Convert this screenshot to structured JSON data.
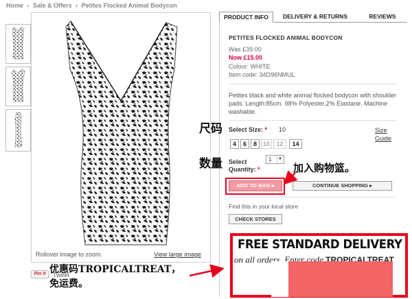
{
  "breadcrumb": {
    "home": "Home",
    "sale": "Sale & Offers",
    "product": "Petites Flocked Animal Bodycon",
    "separator": "›"
  },
  "gallery": {
    "rollover_text": "Rollover image to zoom.",
    "view_large": "View large image"
  },
  "social": {
    "pinit": "Pin it",
    "tweet": "Tweet"
  },
  "tabs": {
    "product_info": "PRODUCT INFO",
    "delivery": "DELIVERY & RETURNS",
    "reviews": "REVIEWS"
  },
  "product": {
    "title": "PETITES FLOCKED ANIMAL BODYCON",
    "was": "Was £39.00",
    "now": "Now £15.00",
    "colour": "Colour: WHITE",
    "item_code": "Item code: 34D96NMUL",
    "description": "Petites black and white animal flocked bodycon with shoulder pads. Length:85cm. 98% Polyester,2% Elastane. Machine washable."
  },
  "size": {
    "label": "Select Size:",
    "required_mark": "*",
    "selected": "10",
    "guide": "Size Guide",
    "options": [
      "4",
      "6",
      "8",
      "10",
      "12",
      "14"
    ],
    "disabled": [
      "10",
      "12"
    ]
  },
  "quantity": {
    "label": "Select Quantity:",
    "required_mark": "*",
    "value": "1",
    "arrow": "▼"
  },
  "actions": {
    "add_to_bag": "ADD TO BAG ▸",
    "continue_shopping": "CONTINUE SHOPPING ▸",
    "find_store": "Find this in your local store",
    "check_stores": "CHECK STORES"
  },
  "promo": {
    "title": "FREE STANDARD DELIVERY",
    "subtitle": "on all orders. Enter code",
    "code": "TROPICALTREAT"
  },
  "annotations": {
    "size": "尺码",
    "quantity": "数量",
    "cart": "加入购物篮。",
    "code_line1": "优惠码TROPICALTREAT，",
    "code_line2": "免运费。"
  },
  "colors": {
    "price_now": "#d6004c",
    "annotation_red": "#e8001c",
    "add_bag_bg": "#f29aa3",
    "promo_block": "#f26466"
  }
}
